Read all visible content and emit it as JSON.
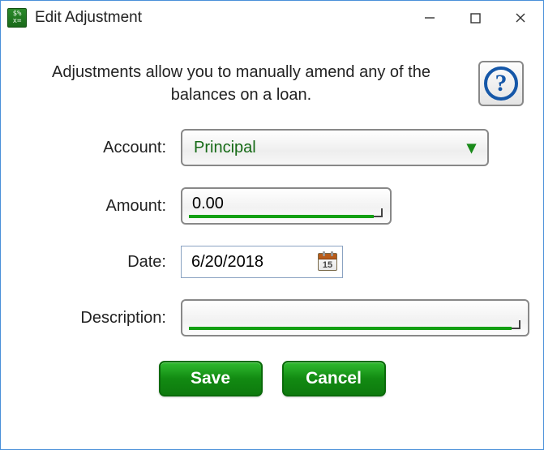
{
  "window": {
    "title": "Edit Adjustment"
  },
  "intro": "Adjustments allow you to manually amend any of the balances on a loan.",
  "form": {
    "account": {
      "label": "Account:",
      "value": "Principal"
    },
    "amount": {
      "label": "Amount:",
      "value": "0.00"
    },
    "date": {
      "label": "Date:",
      "value": "6/20/2018",
      "cal_day": "15"
    },
    "description": {
      "label": "Description:",
      "value": ""
    }
  },
  "buttons": {
    "save": "Save",
    "cancel": "Cancel"
  }
}
